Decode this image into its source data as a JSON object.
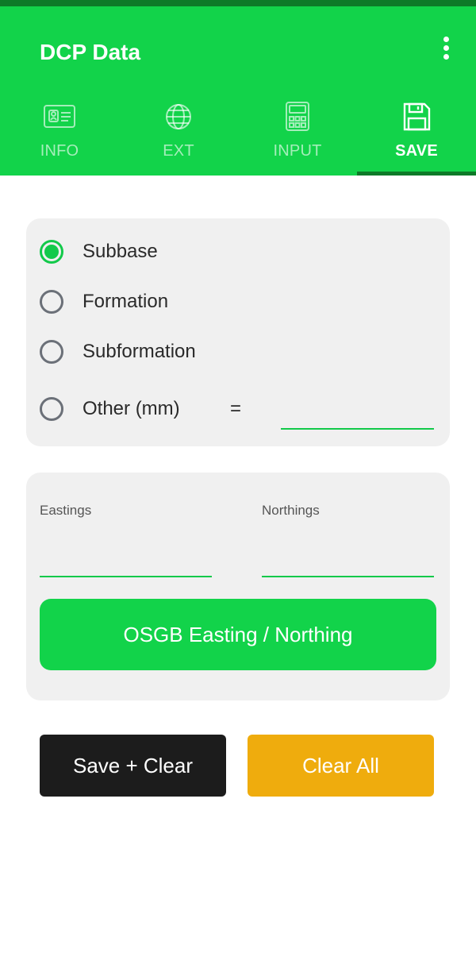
{
  "header": {
    "title": "DCP Data",
    "menu_icon": "more-vertical-icon"
  },
  "tabs": [
    {
      "label": "INFO",
      "icon": "id-card-icon",
      "active": false
    },
    {
      "label": "EXT",
      "icon": "globe-icon",
      "active": false
    },
    {
      "label": "INPUT",
      "icon": "calculator-icon",
      "active": false
    },
    {
      "label": "SAVE",
      "icon": "floppy-disk-icon",
      "active": true
    }
  ],
  "layer_options": {
    "items": [
      {
        "label": "Subbase",
        "checked": true
      },
      {
        "label": "Formation",
        "checked": false
      },
      {
        "label": "Subformation",
        "checked": false
      },
      {
        "label": "Other (mm)",
        "checked": false
      }
    ],
    "equals": "=",
    "other_value": ""
  },
  "coordinates": {
    "eastings_label": "Eastings",
    "eastings_value": "",
    "northings_label": "Northings",
    "northings_value": "",
    "osgb_button": "OSGB Easting / Northing"
  },
  "actions": {
    "save_clear": "Save + Clear",
    "clear_all": "Clear All"
  },
  "colors": {
    "primary": "#12d34a",
    "primary_dark": "#0d7a28",
    "card_bg": "#f0f0f0",
    "dark_button": "#1c1c1c",
    "amber_button": "#efac0d"
  }
}
